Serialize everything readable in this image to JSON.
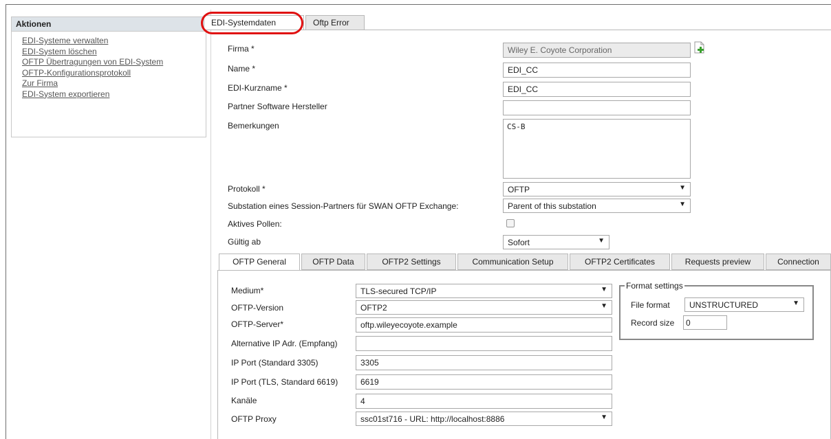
{
  "sidebar": {
    "title": "Aktionen",
    "links": [
      "EDI-Systeme verwalten",
      "EDI-System löschen",
      "OFTP Übertragungen von EDI-System",
      "OFTP-Konfigurationsprotokoll",
      "Zur Firma",
      "EDI-System exportieren"
    ]
  },
  "top_tabs": [
    "EDI-Systemdaten",
    "Oftp Error"
  ],
  "form": {
    "firma_label": "Firma *",
    "firma_value": "Wiley E. Coyote Corporation",
    "name_label": "Name *",
    "name_value": "EDI_CC",
    "kurzname_label": "EDI-Kurzname *",
    "kurzname_value": "EDI_CC",
    "partner_label": "Partner Software Hersteller",
    "partner_value": "",
    "bemerkungen_label": "Bemerkungen",
    "bemerkungen_value": "CS-B",
    "protokoll_label": "Protokoll *",
    "protokoll_value": "OFTP",
    "substation_label": "Substation eines Session-Partners für SWAN OFTP Exchange:",
    "substation_value": "Parent of this substation",
    "pollen_label": "Aktives Pollen:",
    "gueltig_label": "Gültig ab",
    "gueltig_value": "Sofort"
  },
  "sub_tabs": [
    "OFTP General",
    "OFTP Data",
    "OFTP2 Settings",
    "Communication Setup",
    "OFTP2 Certificates",
    "Requests preview",
    "Connection"
  ],
  "oftp": {
    "medium_label": "Medium*",
    "medium_value": "TLS-secured TCP/IP",
    "version_label": "OFTP-Version",
    "version_value": "OFTP2",
    "server_label": "OFTP-Server*",
    "server_value": "oftp.wileyecoyote.example",
    "altip_label": "Alternative IP Adr. (Empfang)",
    "altip_value": "",
    "port_label": "IP Port (Standard 3305)",
    "port_value": "3305",
    "tlsport_label": "IP Port (TLS, Standard 6619)",
    "tlsport_value": "6619",
    "kanaele_label": "Kanäle",
    "kanaele_value": "4",
    "proxy_label": "OFTP Proxy",
    "proxy_value": "ssc01st716 - URL: http://localhost:8886"
  },
  "format": {
    "legend": "Format settings",
    "file_format_label": "File format",
    "file_format_value": "UNSTRUCTURED",
    "record_size_label": "Record size",
    "record_size_value": "0"
  },
  "icons": {
    "add": "add-document-icon",
    "dropdown": "chevron-down-icon"
  },
  "colors": {
    "highlight": "#e01010",
    "sidebar_header": "#dde3e8"
  }
}
